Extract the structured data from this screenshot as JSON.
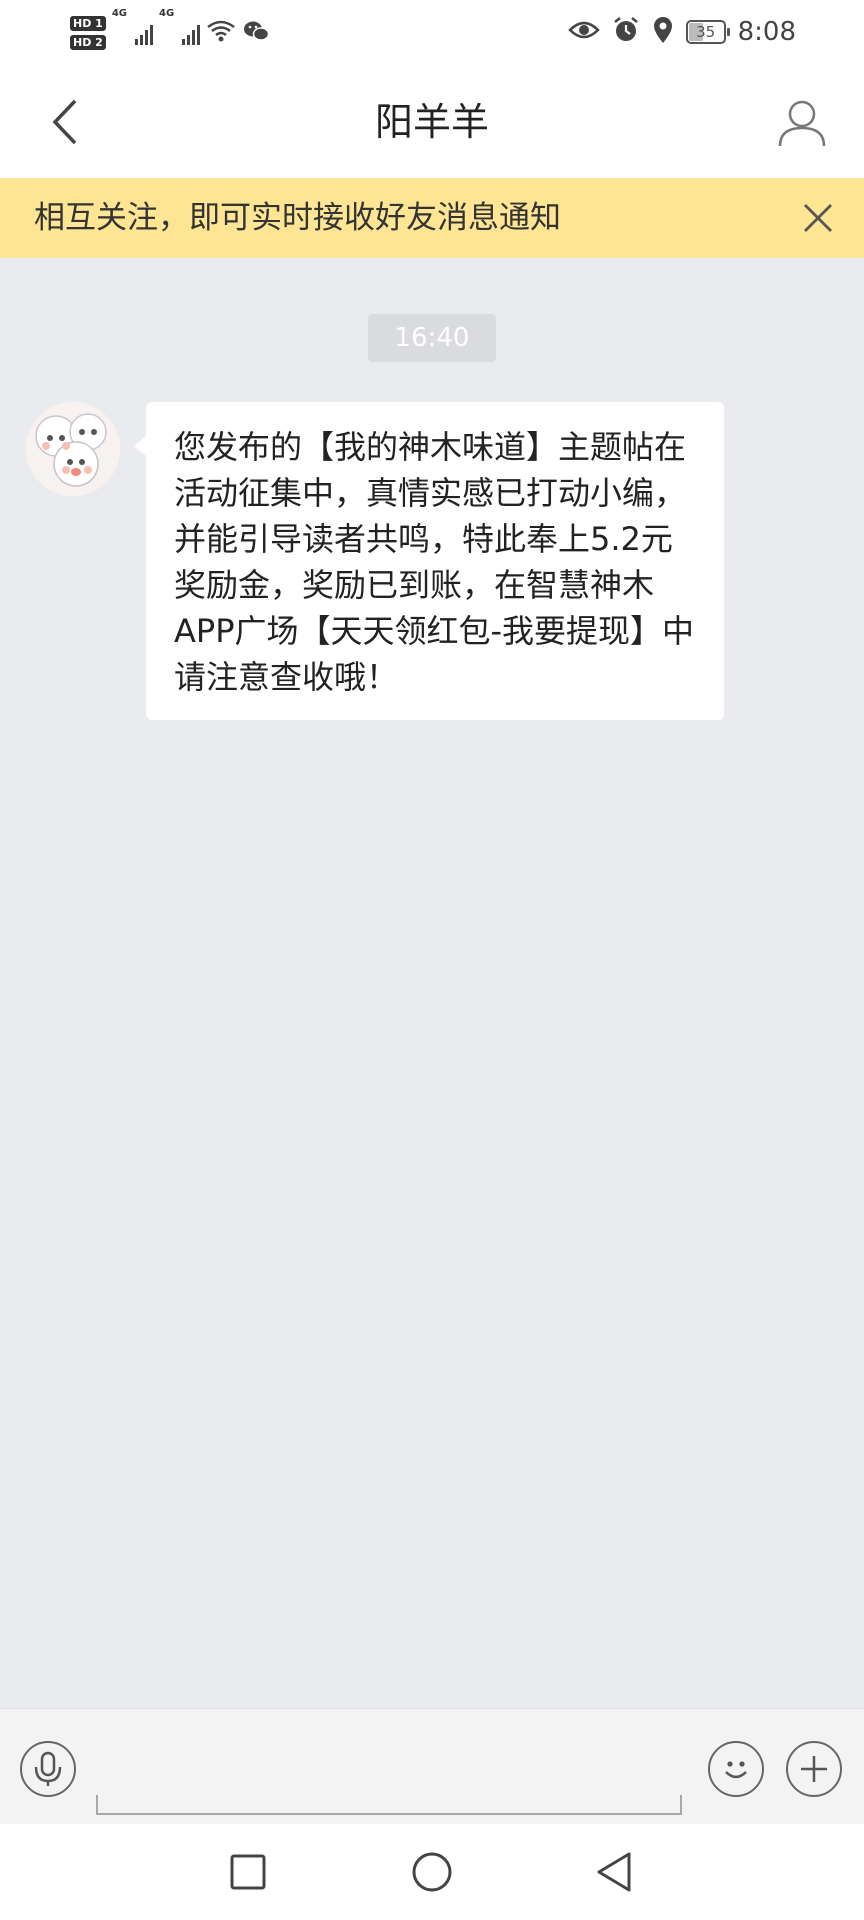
{
  "status_bar": {
    "time": "8:08",
    "battery": "35",
    "sim1": "HD 1",
    "sim2": "HD 2",
    "network1": "4G",
    "network2": "4G",
    "icons": [
      "wifi-icon",
      "wechat-icon",
      "eye-icon",
      "alarm-icon",
      "location-icon",
      "battery-icon"
    ]
  },
  "header": {
    "title": "阳羊羊",
    "back_icon": "chevron-left-icon",
    "profile_icon": "user-icon"
  },
  "notice": {
    "text": "相互关注，即可实时接收好友消息通知",
    "close_icon": "close-icon",
    "color": "#fde594"
  },
  "messages": [
    {
      "time": "16:40",
      "text": "您发布的【我的神木味道】主题帖在活动征集中，真情实感已打动小编，并能引导读者共鸣，特此奉上5.2元奖励金，奖励已到账，在智慧神木APP广场【天天领红包-我要提现】中请注意查收哦！"
    }
  ],
  "input_bar": {
    "value": "",
    "voice_icon": "microphone-icon",
    "emoji_icon": "emoji-icon",
    "plus_icon": "plus-icon"
  },
  "system_nav": {
    "icons": [
      "square-icon",
      "circle-icon",
      "triangle-back-icon"
    ]
  }
}
